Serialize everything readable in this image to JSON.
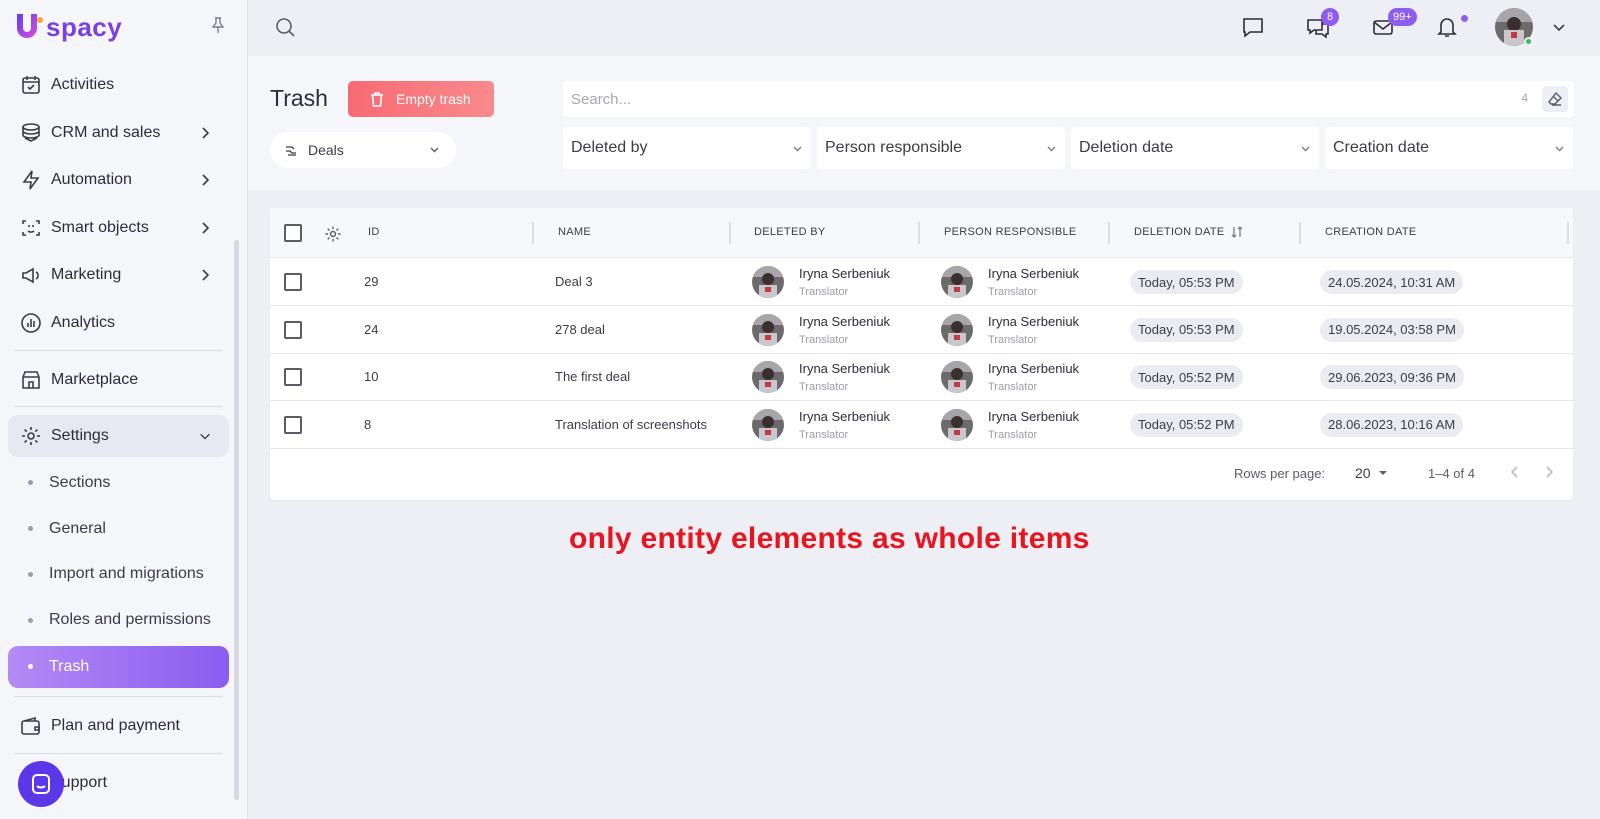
{
  "app": {
    "logo_text": "spacy",
    "brand_color": "#7b3fe4",
    "accent_color": "#8e5cf0"
  },
  "sidebar": {
    "items": [
      {
        "label": "Activities",
        "icon": "calendar-check-icon"
      },
      {
        "label": "CRM and sales",
        "icon": "database-icon",
        "has_submenu": true
      },
      {
        "label": "Automation",
        "icon": "lightning-icon",
        "has_submenu": true
      },
      {
        "label": "Smart objects",
        "icon": "scan-face-icon",
        "has_submenu": true
      },
      {
        "label": "Marketing",
        "icon": "megaphone-icon",
        "has_submenu": true
      },
      {
        "label": "Analytics",
        "icon": "chart-circle-icon"
      },
      {
        "label": "Marketplace",
        "icon": "store-icon"
      },
      {
        "label": "Settings",
        "icon": "gear-icon",
        "expanded": true
      },
      {
        "label": "Plan and payment",
        "icon": "wallet-icon"
      },
      {
        "label": "Support",
        "icon": "chat-icon"
      }
    ],
    "settings_sub": [
      "Sections",
      "General",
      "Import and migrations",
      "Roles and permissions",
      "Trash"
    ],
    "active_sub": "Trash"
  },
  "topbar": {
    "chat_badge": "8",
    "mail_badge": "99+"
  },
  "page": {
    "title": "Trash",
    "empty_button": "Empty trash",
    "entity_select": "Deals",
    "search_placeholder": "Search...",
    "search_count": "4",
    "filters": [
      "Deleted by",
      "Person responsible",
      "Deletion date",
      "Creation date"
    ]
  },
  "table": {
    "columns": [
      "ID",
      "NAME",
      "DELETED BY",
      "PERSON RESPONSIBLE",
      "DELETION DATE",
      "CREATION DATE"
    ],
    "rows": [
      {
        "id": "29",
        "name": "Deal 3",
        "deleted_by": "Iryna Serbeniuk",
        "deleted_by_role": "Translator",
        "responsible": "Iryna Serbeniuk",
        "responsible_role": "Translator",
        "deletion_date": "Today, 05:53 PM",
        "creation_date": "24.05.2024, 10:31 AM"
      },
      {
        "id": "24",
        "name": "278 deal",
        "deleted_by": "Iryna Serbeniuk",
        "deleted_by_role": "Translator",
        "responsible": "Iryna Serbeniuk",
        "responsible_role": "Translator",
        "deletion_date": "Today, 05:53 PM",
        "creation_date": "19.05.2024, 03:58 PM"
      },
      {
        "id": "10",
        "name": "The first deal",
        "deleted_by": "Iryna Serbeniuk",
        "deleted_by_role": "Translator",
        "responsible": "Iryna Serbeniuk",
        "responsible_role": "Translator",
        "deletion_date": "Today, 05:52 PM",
        "creation_date": "29.06.2023, 09:36 PM"
      },
      {
        "id": "8",
        "name": "Translation of screenshots",
        "deleted_by": "Iryna Serbeniuk",
        "deleted_by_role": "Translator",
        "responsible": "Iryna Serbeniuk",
        "responsible_role": "Translator",
        "deletion_date": "Today, 05:52 PM",
        "creation_date": "28.06.2023, 10:16 AM"
      }
    ],
    "rows_per_page_label": "Rows per page:",
    "rows_per_page": "20",
    "range": "1–4 of 4"
  },
  "annotation": "only entity elements as whole items"
}
